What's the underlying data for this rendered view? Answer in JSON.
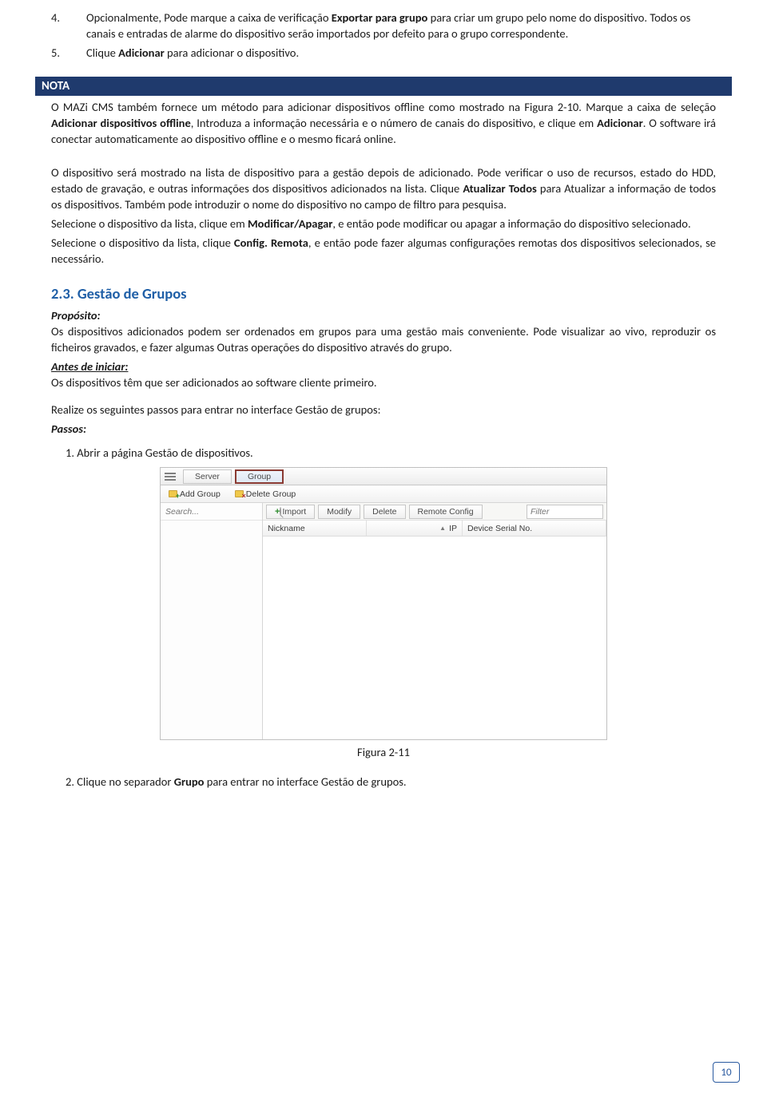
{
  "list": {
    "item4": {
      "num": "4.",
      "text_a": "Opcionalmente, Pode marque a caixa de verificação ",
      "bold_a": "Exportar para grupo",
      "text_b": " para criar um grupo pelo nome do dispositivo. Todos os canais e entradas de alarme do dispositivo serão importados por defeito para o grupo correspondente."
    },
    "item5": {
      "num": "5.",
      "text_a": "Clique ",
      "bold_a": "Adicionar",
      "text_b": " para adicionar o dispositivo."
    }
  },
  "nota": {
    "label": "NOTA",
    "para1_a": "O MAZi CMS também fornece um método para adicionar dispositivos offline como mostrado na Figura 2-10. Marque a caixa de seleção ",
    "para1_bold1": "Adicionar dispositivos offline",
    "para1_b": ", Introduza a informação necessária e o número de canais do dispositivo, e clique em ",
    "para1_bold2": "Adicionar",
    "para1_c": ". O software irá conectar automaticamente ao dispositivo offline e o mesmo ficará online."
  },
  "body": {
    "p1_a": "O dispositivo será mostrado na lista de dispositivo para a gestão depois de adicionado.    Pode verificar o uso de recursos, estado do HDD, estado de gravação, e outras informações dos dispositivos adicionados na lista. Clique ",
    "p1_bold": "Atualizar Todos",
    "p1_b": " para Atualizar a informação de todos os dispositivos. Também pode introduzir o nome do dispositivo no campo de filtro para pesquisa.",
    "p2_a": "Selecione o dispositivo da lista, clique em ",
    "p2_bold": "Modificar/Apagar",
    "p2_b": ", e então pode modificar ou apagar a informação do dispositivo selecionado.",
    "p3_a": "Selecione o dispositivo da lista, clique ",
    "p3_bold": "Config. Remota",
    "p3_b": ", e então pode fazer algumas configurações remotas dos dispositivos selecionados, se necessário."
  },
  "section": {
    "heading": "2.3. Gestão de Grupos",
    "proposito_label": "Propósito:",
    "proposito_text": "Os dispositivos adicionados podem ser ordenados em grupos para uma gestão mais conveniente. Pode visualizar ao vivo, reproduzir os ficheiros gravados, e fazer algumas Outras operações do dispositivo através do grupo.",
    "antes_label": "Antes de iniciar:",
    "antes_text": "Os dispositivos têm que ser adicionados ao software cliente primeiro.",
    "realize": "Realize os seguintes passos para entrar no interface Gestão de grupos:",
    "passos_label": "Passos:",
    "step1": "1. Abrir a página Gestão de dispositivos.",
    "step2_a": "2. Clique no separador ",
    "step2_bold": "Grupo",
    "step2_b": " para entrar no interface Gestão de grupos."
  },
  "figure": {
    "tabs": {
      "server": "Server",
      "group": "Group"
    },
    "toolbar": {
      "add": "Add Group",
      "delete": "Delete Group"
    },
    "search_placeholder": "Search...",
    "rbuttons": {
      "import": "Import",
      "modify": "Modify",
      "delete": "Delete",
      "remote": "Remote Config"
    },
    "filter_placeholder": "Filter",
    "headers": {
      "nickname": "Nickname",
      "ip": "IP",
      "serial": "Device Serial No."
    },
    "caption": "Figura 2-11"
  },
  "page_number": "10"
}
